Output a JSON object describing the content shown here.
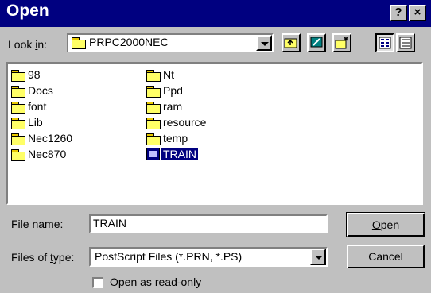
{
  "dialog": {
    "title": "Open",
    "help_label": "?",
    "close_label": "×"
  },
  "look_in": {
    "label_pre": "Look ",
    "label_ul": "i",
    "label_post": "n:",
    "value": "PRPC2000NEC"
  },
  "files": [
    {
      "name": "98",
      "type": "folder"
    },
    {
      "name": "Docs",
      "type": "folder"
    },
    {
      "name": "font",
      "type": "folder"
    },
    {
      "name": "Lib",
      "type": "folder"
    },
    {
      "name": "Nec1260",
      "type": "folder"
    },
    {
      "name": "Nec870",
      "type": "folder"
    },
    {
      "name": "Nt",
      "type": "folder"
    },
    {
      "name": "Ppd",
      "type": "folder"
    },
    {
      "name": "ram",
      "type": "folder"
    },
    {
      "name": "resource",
      "type": "folder"
    },
    {
      "name": "temp",
      "type": "folder"
    },
    {
      "name": "TRAIN",
      "type": "file",
      "selected": true
    }
  ],
  "file_name": {
    "label_pre": "File ",
    "label_ul": "n",
    "label_post": "ame:",
    "value": "TRAIN"
  },
  "file_type": {
    "label_pre": "Files of ",
    "label_ul": "t",
    "label_post": "ype:",
    "value": "PostScript Files (*.PRN, *.PS)"
  },
  "buttons": {
    "open_ul": "O",
    "open_rest": "pen",
    "cancel": "Cancel"
  },
  "read_only": {
    "ul": "O",
    "rest_a": "pen as ",
    "ul2": "r",
    "rest_b": "ead-only",
    "checked": false
  },
  "colors": {
    "titlebar": "#000080",
    "face": "#c0c0c0",
    "selection": "#000080"
  }
}
